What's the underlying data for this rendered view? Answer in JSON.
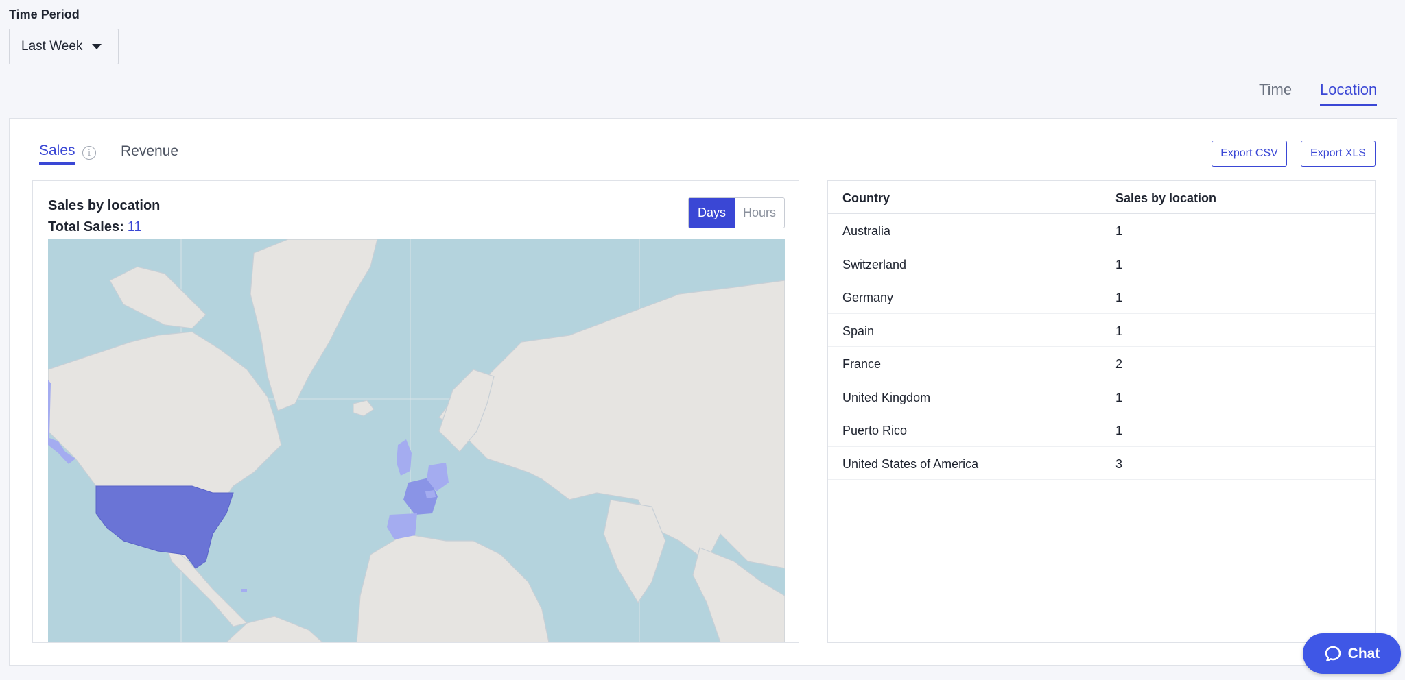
{
  "filter": {
    "label": "Time Period",
    "selected": "Last Week"
  },
  "view_tabs": {
    "time": "Time",
    "location": "Location"
  },
  "metric_tabs": {
    "sales": "Sales",
    "revenue": "Revenue"
  },
  "export": {
    "csv": "Export CSV",
    "xls": "Export XLS"
  },
  "map": {
    "title": "Sales by location",
    "total_label": "Total Sales:",
    "total_value": "11",
    "toggle": {
      "days": "Days",
      "hours": "Hours",
      "selected": "Days"
    },
    "colors": {
      "ocean": "#b4d3dd",
      "land": "#e6e4e1",
      "border": "#c7cfd6",
      "high": "#6a74d6",
      "mid": "#8a94e6",
      "low": "#a4acf0"
    }
  },
  "table": {
    "headers": [
      "Country",
      "Sales by location"
    ],
    "rows": [
      {
        "country": "Australia",
        "sales": "1"
      },
      {
        "country": "Switzerland",
        "sales": "1"
      },
      {
        "country": "Germany",
        "sales": "1"
      },
      {
        "country": "Spain",
        "sales": "1"
      },
      {
        "country": "France",
        "sales": "2"
      },
      {
        "country": "United Kingdom",
        "sales": "1"
      },
      {
        "country": "Puerto Rico",
        "sales": "1"
      },
      {
        "country": "United States of America",
        "sales": "3"
      }
    ]
  },
  "chat": {
    "label": "Chat"
  },
  "colors": {
    "accent": "#3a47d5",
    "chat": "#3f57e6"
  }
}
